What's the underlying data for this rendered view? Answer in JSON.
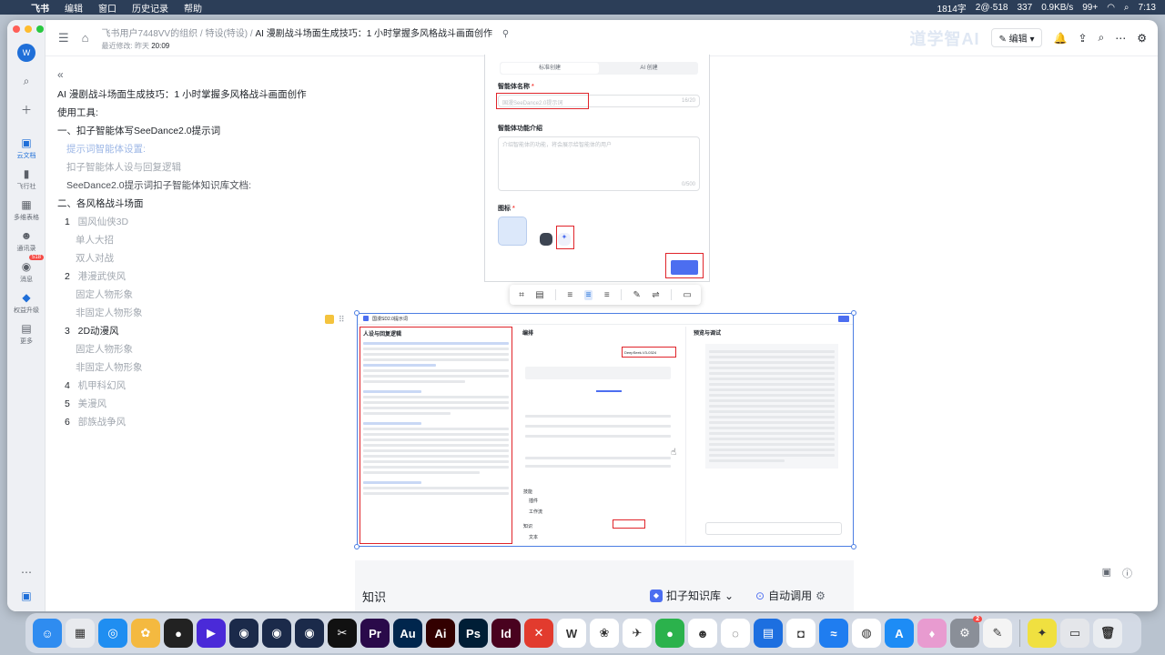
{
  "menubar": {
    "items": [
      "飞书",
      "编辑",
      "窗口",
      "历史记录",
      "帮助"
    ],
    "status": [
      "1814字",
      "2@·518",
      "337",
      "99+",
      "7:13"
    ],
    "net": "0.9KB/s"
  },
  "sidebar": {
    "avatar": "W",
    "items": [
      {
        "label": "云文档",
        "icon": "doc-icon"
      },
      {
        "label": "飞行社",
        "icon": "plane-icon"
      },
      {
        "label": "多维表格",
        "icon": "grid-icon"
      },
      {
        "label": "通讯录",
        "icon": "contacts-icon"
      },
      {
        "label": "消息",
        "icon": "message-icon",
        "badge": "518"
      },
      {
        "label": "权益升级",
        "icon": "diamond-icon"
      },
      {
        "label": "更多",
        "icon": "more-icon"
      }
    ]
  },
  "topbar": {
    "org": "飞书用户7448VV的组织",
    "folder": "特设(特设)",
    "title": "AI 漫剧战斗场面生成技巧：1 小时掌握多风格战斗画面创作",
    "modified_label": "最近修改: 昨天",
    "modified_time": "20:09",
    "watermark": "道学智AI",
    "edit_label": "编辑"
  },
  "outline": {
    "title": "AI 漫剧战斗场面生成技巧：1 小时掌握多风格战斗画面创作",
    "tools": "使用工具:",
    "section1": "一、扣子智能体写SeeDance2.0提示词",
    "s1_items": [
      "提示词智能体设置:",
      "扣子智能体人设与回复逻辑",
      "SeeDance2.0提示词扣子智能体知识库文档:"
    ],
    "section2": "二、各风格战斗场面",
    "styles": [
      {
        "num": "1",
        "name": "国风仙侠3D",
        "subs": [
          "单人大招",
          "双人对战"
        ]
      },
      {
        "num": "2",
        "name": "港漫武侠风",
        "subs": [
          "固定人物形象",
          "非固定人物形象"
        ]
      },
      {
        "num": "3",
        "name": "2D动漫风",
        "subs": [
          "固定人物形象",
          "非固定人物形象"
        ]
      },
      {
        "num": "4",
        "name": "机甲科幻风",
        "subs": []
      },
      {
        "num": "5",
        "name": "美漫风",
        "subs": []
      },
      {
        "num": "6",
        "name": "部族战争风",
        "subs": []
      }
    ]
  },
  "img1": {
    "tabs": [
      "标准创建",
      "AI 创建"
    ],
    "name_label": "智能体名称",
    "name_placeholder": "国漫SeeDance2.0提示词",
    "name_count": "16/20",
    "intro_label": "智能体功能介绍",
    "intro_placeholder": "介绍智能体的功能，将会展示给智能体的用户",
    "intro_count": "0/500",
    "icon_label": "图标"
  },
  "img2": {
    "app_name": "国漫SD2.0提示词",
    "left_title": "人设与回复逻辑",
    "mid_title": "编排",
    "model": "DeepSeek-V3-0324",
    "right_title": "预览与调试",
    "skills": "技能",
    "plugins": "插件",
    "workflow": "工作流",
    "knowledge": "知识",
    "text": "文本"
  },
  "img3": {
    "knowledge": "知识",
    "kb": "扣子知识库",
    "auto": "自动调用",
    "text": "文本",
    "plus": "+"
  },
  "dock": [
    {
      "name": "finder",
      "color": "#2f8cf0",
      "glyph": "☺"
    },
    {
      "name": "launchpad",
      "color": "#e8eaee",
      "glyph": "▦"
    },
    {
      "name": "safari",
      "color": "#1f8ef1",
      "glyph": "◎"
    },
    {
      "name": "photos",
      "color": "#f4b940",
      "glyph": "✿"
    },
    {
      "name": "obs",
      "color": "#222222",
      "glyph": "●"
    },
    {
      "name": "video",
      "color": "#4a2ad8",
      "glyph": "▶"
    },
    {
      "name": "c4d-1",
      "color": "#1b2a4a",
      "glyph": "◉"
    },
    {
      "name": "c4d-2",
      "color": "#1b2a4a",
      "glyph": "◉"
    },
    {
      "name": "c4d-3",
      "color": "#1b2a4a",
      "glyph": "◉"
    },
    {
      "name": "capcut",
      "color": "#111111",
      "glyph": "✂"
    },
    {
      "name": "premiere",
      "color": "#2a0a4a",
      "glyph": "Pr"
    },
    {
      "name": "audition",
      "color": "#00264d",
      "glyph": "Au"
    },
    {
      "name": "illustrator",
      "color": "#330000",
      "glyph": "Ai"
    },
    {
      "name": "photoshop",
      "color": "#001e36",
      "glyph": "Ps"
    },
    {
      "name": "indesign",
      "color": "#49021f",
      "glyph": "Id"
    },
    {
      "name": "xmind",
      "color": "#e23b2e",
      "glyph": "✕"
    },
    {
      "name": "wps",
      "color": "#ffffff",
      "glyph": "W"
    },
    {
      "name": "app-flower",
      "color": "#ffffff",
      "glyph": "❀"
    },
    {
      "name": "feishu",
      "color": "#ffffff",
      "glyph": "✈"
    },
    {
      "name": "wechat",
      "color": "#2bb24c",
      "glyph": "●"
    },
    {
      "name": "qq",
      "color": "#ffffff",
      "glyph": "☻"
    },
    {
      "name": "chat-bubble",
      "color": "#ffffff",
      "glyph": "◌"
    },
    {
      "name": "app-blue",
      "color": "#1d6fe0",
      "glyph": "▤"
    },
    {
      "name": "app-bag",
      "color": "#ffffff",
      "glyph": "◘"
    },
    {
      "name": "app-wave",
      "color": "#1f7df0",
      "glyph": "≈"
    },
    {
      "name": "chrome",
      "color": "#ffffff",
      "glyph": "◍"
    },
    {
      "name": "app-store",
      "color": "#1d8cf5",
      "glyph": "A"
    },
    {
      "name": "cat-app",
      "color": "#e89bd0",
      "glyph": "♦"
    },
    {
      "name": "settings",
      "color": "#8a8f98",
      "glyph": "⚙",
      "badge": "2"
    },
    {
      "name": "notes",
      "color": "#f4f4f4",
      "glyph": "✎"
    },
    {
      "name": "app-green",
      "color": "#f0e040",
      "glyph": "✦"
    },
    {
      "name": "screenshot",
      "color": "#e4e6ea",
      "glyph": "▭"
    },
    {
      "name": "trash",
      "color": "#e9ecf0",
      "glyph": "🗑"
    }
  ]
}
